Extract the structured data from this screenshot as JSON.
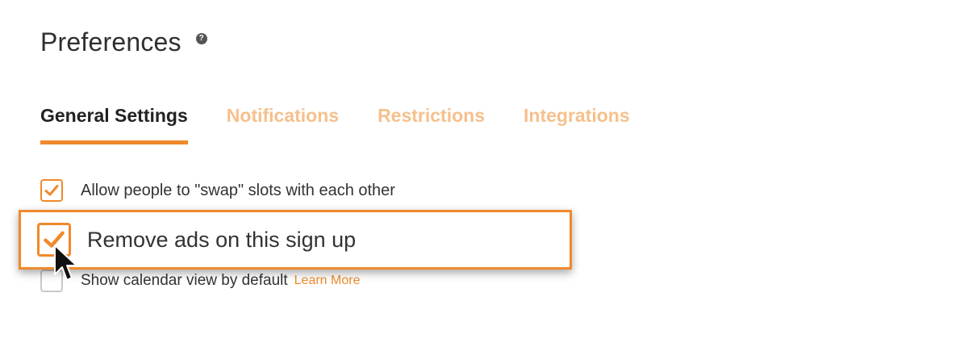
{
  "theme": {
    "accent": "#f0892b",
    "inactive_tab": "#f6c08c"
  },
  "header": {
    "title": "Preferences",
    "help_icon": "question-circle-icon",
    "help_glyph": "?"
  },
  "tabs": [
    {
      "label": "General Settings",
      "active": true
    },
    {
      "label": "Notifications",
      "active": false
    },
    {
      "label": "Restrictions",
      "active": false
    },
    {
      "label": "Integrations",
      "active": false
    }
  ],
  "settings": [
    {
      "label": "Allow people to \"swap\" slots with each other",
      "checked": true
    },
    {
      "label": "Remove ads on this sign up",
      "checked": true,
      "highlighted": true
    },
    {
      "label": "Show calendar view by default",
      "checked": false,
      "link": "Learn More"
    }
  ],
  "cursor": {
    "icon": "mouse-pointer-icon"
  }
}
